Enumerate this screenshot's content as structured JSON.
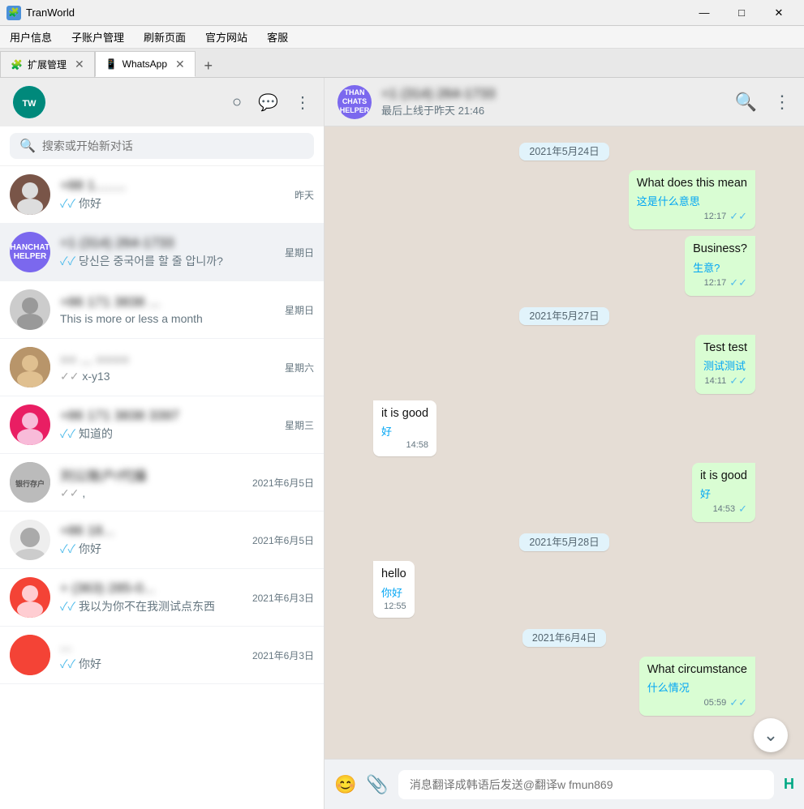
{
  "titlebar": {
    "icon": "🧩",
    "title": "TranWorld",
    "minimize": "—",
    "maximize": "□",
    "close": "✕"
  },
  "menubar": {
    "items": [
      "用户信息",
      "子账户管理",
      "刷新页面",
      "官方网站",
      "客服"
    ]
  },
  "tabs": [
    {
      "id": "tab1",
      "icon": "🧩",
      "label": "扩展管理",
      "active": false
    },
    {
      "id": "tab2",
      "icon": "📱",
      "label": "WhatsApp",
      "active": true
    }
  ],
  "tab_add": "+",
  "sidebar": {
    "header": {
      "avatar_text": "TW",
      "icons": [
        "○",
        "💬",
        "⋮"
      ]
    },
    "search": {
      "placeholder": "搜索或开始新对话"
    },
    "chats": [
      {
        "id": "c1",
        "avatar_color": "av-brown",
        "name": "+88 1...",
        "name_blurred": true,
        "time": "昨天",
        "tick": "✓✓",
        "preview": "你好"
      },
      {
        "id": "c2",
        "avatar_color": "av-purple",
        "avatar_text": "TH",
        "name": "+1 (314) 264-1733",
        "name_blurred": true,
        "time": "星期日",
        "tick": "✓✓",
        "preview": "당신은 중국어를 할 줄 압니까?",
        "active": true
      },
      {
        "id": "c3",
        "avatar_color": "av-pink",
        "name": "+86 171 3838 ...",
        "name_blurred": true,
        "time": "星期日",
        "tick": "",
        "preview": "This is more or less a month"
      },
      {
        "id": "c4",
        "avatar_color": "av-orange",
        "name": "○○ ......... ○○○○",
        "name_blurred": true,
        "time": "星期六",
        "tick": "✓✓",
        "preview": "x-y13"
      },
      {
        "id": "c5",
        "avatar_color": "av-pink",
        "name": "+86 171 3838 3397",
        "name_blurred": true,
        "time": "星期三",
        "tick": "✓✓",
        "preview": "知道的"
      },
      {
        "id": "c6",
        "avatar_color": "av-grey",
        "name": "刘公账户/代操",
        "name_blurred": true,
        "time": "2021年6月5日",
        "tick": "✓✓",
        "preview": ","
      },
      {
        "id": "c7",
        "avatar_color": "av-grey",
        "name": "+86 18...",
        "name_blurred": true,
        "time": "2021年6月5日",
        "tick": "✓✓",
        "preview": "你好"
      },
      {
        "id": "c8",
        "avatar_color": "av-red",
        "name": "+ (363) 285-0...",
        "name_blurred": true,
        "time": "2021年6月3日",
        "tick": "✓✓",
        "preview": "我以为你不在我测试点东西"
      },
      {
        "id": "c9",
        "avatar_color": "av-red",
        "name": "...",
        "name_blurred": true,
        "time": "2021年6月3日",
        "tick": "✓✓",
        "preview": "你好"
      }
    ]
  },
  "chat": {
    "contact_name": "+1 (314) 264-1733",
    "contact_status": "最后上线于昨天 21:46",
    "messages": [
      {
        "type": "date",
        "text": "2021年5月24日"
      },
      {
        "type": "sent",
        "text": "What does this mean",
        "translation": "这是什么意思",
        "time": "12:17",
        "tick": "✓✓"
      },
      {
        "type": "sent",
        "text": "Business?",
        "translation": "生意?",
        "time": "12:17",
        "tick": "✓✓"
      },
      {
        "type": "date",
        "text": "2021年5月27日"
      },
      {
        "type": "sent",
        "text": "Test test",
        "translation": "测试测试",
        "time": "14:11",
        "tick": "✓✓"
      },
      {
        "type": "received",
        "text": "it is good",
        "translation": "好",
        "time": "14:58"
      },
      {
        "type": "sent",
        "text": "it is good",
        "translation": "好",
        "time": "14:53",
        "tick": "✓"
      },
      {
        "type": "date",
        "text": "2021年5月28日"
      },
      {
        "type": "received",
        "text": "hello",
        "translation": "你好",
        "time": "12:55"
      },
      {
        "type": "date",
        "text": "2021年6月4日"
      },
      {
        "type": "sent",
        "text": "What circumstance",
        "translation": "什么情况",
        "time": "05:59",
        "tick": "✓✓"
      }
    ]
  },
  "input_bar": {
    "emoji_icon": "😊",
    "attach_icon": "📎",
    "placeholder": "消息翻译成韩语后发送@翻译w fmun869",
    "send_icon": "H"
  }
}
